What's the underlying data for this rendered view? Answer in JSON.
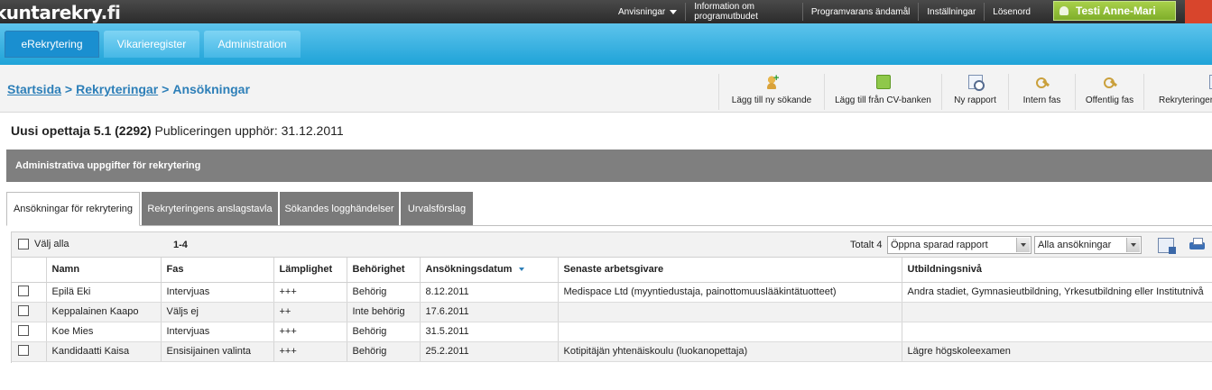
{
  "topbar": {
    "logo_text": "kuntarekry",
    "logo_suffix": ".fi",
    "nav": [
      {
        "label": "Anvisningar"
      },
      {
        "label_line1": "Information om",
        "label_line2": "programutbudet"
      },
      {
        "label": "Programvarans ändamål"
      },
      {
        "label": "Inställningar"
      },
      {
        "label": "Lösenord"
      }
    ],
    "user": "Testi Anne-Mari"
  },
  "mainnav": {
    "tabs": [
      {
        "label": "eRekrytering",
        "active": true
      },
      {
        "label": "Vikarieregister",
        "active": false
      },
      {
        "label": "Administration",
        "active": false
      }
    ]
  },
  "breadcrumb": {
    "items": [
      "Startsida",
      "Rekryteringar"
    ],
    "current": "Ansökningar",
    "separator": ">"
  },
  "toolbar": {
    "buttons": [
      {
        "label": "Lägg till ny sökande",
        "icon": "add-person-icon"
      },
      {
        "label": "Lägg till från CV-banken",
        "icon": "cv-bank-icon"
      },
      {
        "label": "Ny rapport",
        "icon": "report-icon"
      },
      {
        "label": "Intern fas",
        "icon": "key-icon"
      },
      {
        "label": "Offentlig fas",
        "icon": "key-icon"
      },
      {
        "label": "Rekryteringer",
        "icon": "document-icon"
      }
    ]
  },
  "posting": {
    "title": "Uusi opettaja 5.1 (2292)",
    "publication_label": "Publiceringen upphör: 31.12.2011"
  },
  "section": {
    "title": "Administrativa uppgifter för rekrytering"
  },
  "tabs": [
    {
      "label": "Ansökningar för rekrytering",
      "active": true
    },
    {
      "label": "Rekryteringens anslagstavla",
      "active": false
    },
    {
      "label": "Sökandes logghändelser",
      "active": false
    },
    {
      "label": "Urvalsförslag",
      "active": false
    }
  ],
  "controls": {
    "select_all": "Välj alla",
    "range": "1-4",
    "total": "Totalt 4",
    "report_select": "Öppna sparad rapport",
    "filter_select": "Alla ansökningar"
  },
  "table": {
    "columns": [
      "Namn",
      "Fas",
      "Lämplighet",
      "Behörighet",
      "Ansökningsdatum",
      "Senaste arbetsgivare",
      "Utbildningsnivå"
    ],
    "rows": [
      [
        "Epilä Eki",
        "Intervjuas",
        "+++",
        "Behörig",
        "8.12.2011",
        "Medispace Ltd (myyntiedustaja, painottomuuslääkintätuotteet)",
        "Andra stadiet, Gymnasieutbildning, Yrkesutbildning eller Institutnivå"
      ],
      [
        "Keppalainen Kaapo",
        "Väljs ej",
        "++",
        "Inte behörig",
        "17.6.2011",
        "",
        ""
      ],
      [
        "Koe Mies",
        "Intervjuas",
        "+++",
        "Behörig",
        "31.5.2011",
        "",
        ""
      ],
      [
        "Kandidaatti Kaisa",
        "Ensisijainen valinta",
        "+++",
        "Behörig",
        "25.2.2011",
        "Kotipitäjän yhtenäiskoulu (luokanopettaja)",
        "Lägre högskoleexamen"
      ]
    ]
  }
}
